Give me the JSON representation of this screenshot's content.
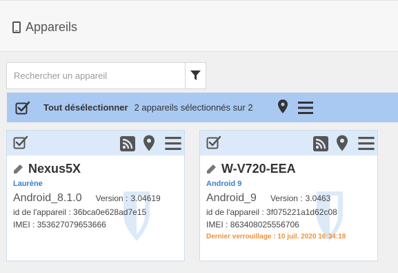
{
  "header": {
    "title": "Appareils",
    "icon": "tablet-icon"
  },
  "search": {
    "placeholder": "Rechercher un appareil",
    "value": ""
  },
  "selection": {
    "deselect_label": "Tout désélectionner",
    "count_text": "2 appareils sélectionnés sur 2"
  },
  "colors": {
    "selection_bar": "#a9c9f3",
    "card_header": "#dce9f8",
    "user_link": "#3a7fc8",
    "lock_warning": "#f0913a",
    "shield": "#dce9f8"
  },
  "devices": [
    {
      "name": "Nexus5X",
      "user": "Laurène",
      "os": "Android_8.1.0",
      "version_label": "Version :",
      "version": "3.04619",
      "device_id_label": "id de l'appareil :",
      "device_id": "36bca0e628ad7e15",
      "imei_label": "IMEI :",
      "imei": "353627079653666"
    },
    {
      "name": "W-V720-EEA",
      "user": "Android 9",
      "os": "Android_9",
      "version_label": "Version :",
      "version": "3.0463",
      "device_id_label": "id de l'appareil :",
      "device_id": "3f075221a1d62c08",
      "imei_label": "IMEI :",
      "imei": "863408025556706",
      "last_lock": "Dernier verrouillage : 10 juil. 2020 16:34:18"
    }
  ]
}
